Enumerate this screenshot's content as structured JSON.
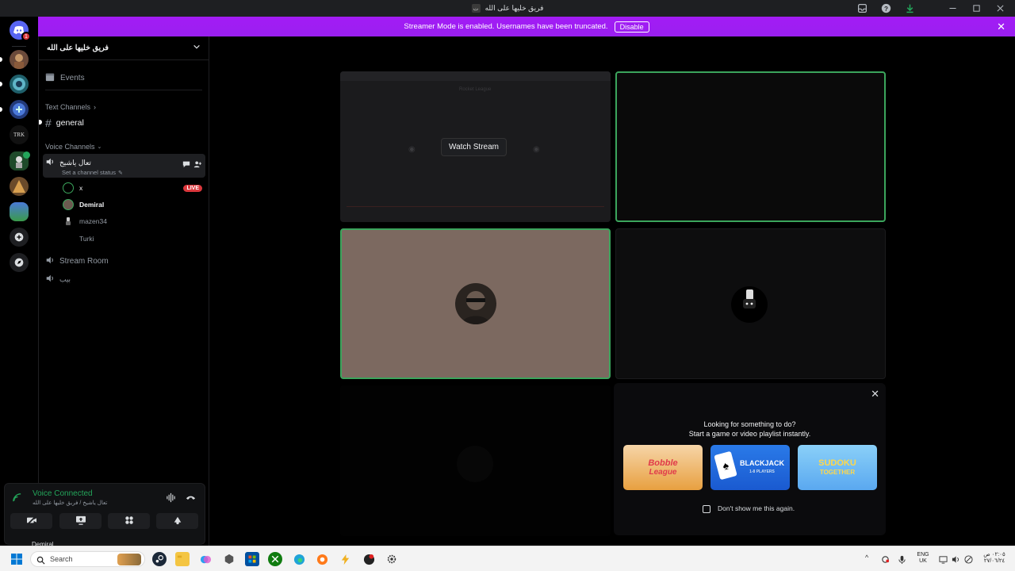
{
  "window": {
    "title": "فريق خليها على الله",
    "server_mini": "ت"
  },
  "banner": {
    "text": "Streamer Mode is enabled. Usernames have been truncated.",
    "disable_label": "Disable"
  },
  "rail": {
    "notification_count": "1",
    "trk_label": "TRK"
  },
  "server": {
    "name": "فريق خليها على الله"
  },
  "sidebar": {
    "events_label": "Events",
    "text_channels_label": "Text Channels",
    "general_channel": "general",
    "voice_channels_label": "Voice Channels",
    "voice_channel_active": "تعال ياشيخ",
    "channel_status_placeholder": "Set a channel status",
    "members": [
      {
        "name": "x",
        "live": "LIVE"
      },
      {
        "name": "Demiral"
      },
      {
        "name": "mazen34"
      },
      {
        "name": "Turki"
      }
    ],
    "stream_room": "Stream Room",
    "third_voice": "بيب"
  },
  "voice_panel": {
    "status": "Voice Connected",
    "location": "تعال ياشيخ / فريق خليها على الله",
    "user_peek": "Demiral"
  },
  "main": {
    "watch_stream_label": "Watch Stream",
    "stream_preview_title": "Rocket League"
  },
  "activity": {
    "heading": "Looking for something to do?",
    "subheading": "Start a game or video playlist instantly.",
    "games": [
      {
        "name": "Bobble League",
        "line1": "Bobble",
        "line2": "League"
      },
      {
        "name": "Blackjack",
        "line1": "BLACKJACK",
        "line2": "1-8 PLAYERS"
      },
      {
        "name": "Sudoku Together",
        "line1": "SUDOKU",
        "line2": "TOGETHER"
      }
    ],
    "dont_show_label": "Don't show me this again."
  },
  "taskbar": {
    "search_placeholder": "Search",
    "lang_top": "ENG",
    "lang_bottom": "UK",
    "time": "٠٢:٠٥ ص",
    "date": "٢٧/٠٦/٢٤"
  },
  "colors": {
    "brand": "#5865f2",
    "banner": "#a31cf5",
    "speaking_green": "#3ba55c",
    "live_red": "#da373c",
    "tile_brown": "#7c6960",
    "voice_green": "#23a55a"
  }
}
